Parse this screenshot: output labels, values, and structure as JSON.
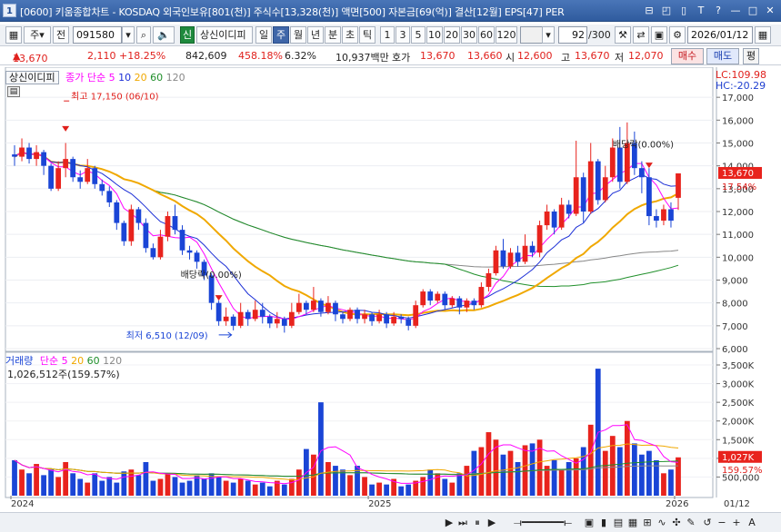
{
  "window": {
    "badge": "1",
    "title": "[0600] 키움종합차트 - KOSDAQ 외국인보유[801(천)] 주식수[13,328(천)] 액면[500] 자본금[69(억)] 결산[12월] EPS[47] PER",
    "buttons": [
      "⊟",
      "◰",
      "▯",
      "T",
      "?",
      "—",
      "□",
      "✕"
    ]
  },
  "toolbar": {
    "mode_label": "주",
    "prev_label": "전",
    "code_value": "091580",
    "stock_badge": "신",
    "stock_name": "상신이디피",
    "periods": [
      "일",
      "주",
      "월",
      "년",
      "분",
      "초",
      "틱"
    ],
    "selected_period": "주",
    "intervals": [
      "1",
      "3",
      "5",
      "10",
      "20",
      "30",
      "60",
      "120"
    ],
    "count_value": "92",
    "count_total": "/300",
    "date_value": "2026/01/12"
  },
  "quote": {
    "price": "13,670",
    "change": "2,110",
    "change_pct": "+18.25%",
    "volume": "842,609",
    "vol_ratio": "458.18%",
    "turnover": "6.32%",
    "amount": "10,937백만",
    "bid_label": "호가",
    "bid": "13,670",
    "ask": "13,660",
    "open_label": "시",
    "open": "12,600",
    "high_label": "고",
    "high": "13,670",
    "low_label": "저",
    "low": "12,070",
    "buy_label": "매수",
    "sell_label": "매도",
    "eval_label": "평"
  },
  "price_panel": {
    "name_box": "상신이디피",
    "legend_prefix": "종가 단순",
    "ma": [
      "5",
      "10",
      "20",
      "60",
      "120"
    ],
    "lc": "LC:109.98",
    "hc": "HC:-20.29",
    "annotations": {
      "high": "최고 17,150 (06/10)",
      "low": "최저 6,510 (12/09)",
      "div1": "배당락(0.00%)",
      "div2": "배당락(0.00%)"
    },
    "right_tag_price": "13,670",
    "right_tag_pct": "17.54%"
  },
  "volume_panel": {
    "name_box": "거래량",
    "legend_prefix": "단순",
    "ma": [
      "5",
      "20",
      "60",
      "120"
    ],
    "current": "1,026,512주(159.57%)",
    "right_tag_vol": "1,027K",
    "right_tag_pct": "159.57%"
  },
  "x_axis": {
    "labels": [
      "2024",
      "2025",
      "2026"
    ],
    "right_date": "01/12"
  },
  "colors": {
    "up": "#e8231d",
    "down": "#1a45d6",
    "ma5": "#ff00ff",
    "ma10": "#1c2fd6",
    "ma20": "#f0a800",
    "ma60": "#1f8f2a",
    "ma120": "#888888"
  },
  "chart_data": {
    "type": "candlestick",
    "ylim_price": [
      6000,
      18000
    ],
    "price_ticks": [
      6000,
      7000,
      8000,
      9000,
      10000,
      11000,
      12000,
      13000,
      14000,
      15000,
      16000,
      17000
    ],
    "ylim_volume": [
      0,
      3500000
    ],
    "volume_ticks": [
      "500,000",
      "1,000K",
      "1,500K",
      "2,000K",
      "2,500K",
      "3,000K",
      "3,500K"
    ],
    "candles": [
      [
        14500,
        14400,
        14900,
        14000
      ],
      [
        14400,
        14800,
        15200,
        14200
      ],
      [
        14800,
        14300,
        15000,
        14100
      ],
      [
        14300,
        14600,
        14900,
        14000
      ],
      [
        14600,
        14000,
        14700,
        13600
      ],
      [
        14000,
        13000,
        14100,
        12900
      ],
      [
        13000,
        13900,
        14200,
        12900
      ],
      [
        13900,
        14300,
        15000,
        13500
      ],
      [
        14300,
        13500,
        14400,
        13300
      ],
      [
        13500,
        13300,
        13800,
        13000
      ],
      [
        13300,
        13900,
        14300,
        13200
      ],
      [
        13900,
        13200,
        14000,
        13000
      ],
      [
        13200,
        12900,
        13400,
        12700
      ],
      [
        12900,
        12400,
        13100,
        12200
      ],
      [
        12400,
        11500,
        12500,
        11200
      ],
      [
        11500,
        10700,
        11600,
        10500
      ],
      [
        10700,
        12100,
        12300,
        10500
      ],
      [
        12100,
        11500,
        12200,
        11200
      ],
      [
        11500,
        10400,
        11700,
        10200
      ],
      [
        10400,
        10000,
        10600,
        9900
      ],
      [
        10000,
        10900,
        11200,
        9900
      ],
      [
        10900,
        11800,
        12000,
        10700
      ],
      [
        11800,
        11200,
        12300,
        11000
      ],
      [
        11200,
        10300,
        11400,
        10100
      ],
      [
        10300,
        10200,
        10500,
        9900
      ],
      [
        10200,
        9800,
        10300,
        9500
      ],
      [
        9800,
        9200,
        9900,
        9000
      ],
      [
        9200,
        8000,
        9300,
        7700
      ],
      [
        8000,
        7200,
        8100,
        7000
      ],
      [
        7200,
        7400,
        7800,
        7000
      ],
      [
        7400,
        7000,
        7500,
        6800
      ],
      [
        7000,
        7600,
        8000,
        6900
      ],
      [
        7600,
        7300,
        7700,
        7000
      ],
      [
        7300,
        7700,
        8100,
        7200
      ],
      [
        7700,
        7400,
        8000,
        7100
      ],
      [
        7400,
        7100,
        7500,
        6900
      ],
      [
        7100,
        7300,
        7600,
        6900
      ],
      [
        7300,
        7000,
        7400,
        6700
      ],
      [
        7000,
        7600,
        8000,
        6900
      ],
      [
        7600,
        8000,
        8400,
        7500
      ],
      [
        8000,
        7700,
        8100,
        7500
      ],
      [
        7700,
        8100,
        8700,
        7600
      ],
      [
        8100,
        7600,
        8200,
        7400
      ],
      [
        7600,
        8000,
        8300,
        7500
      ],
      [
        8000,
        7500,
        8100,
        7200
      ],
      [
        7500,
        7300,
        7600,
        7100
      ],
      [
        7300,
        7700,
        7800,
        7200
      ],
      [
        7700,
        7300,
        7800,
        7100
      ],
      [
        7300,
        7500,
        7700,
        7100
      ],
      [
        7500,
        7200,
        7600,
        7000
      ],
      [
        7200,
        7500,
        7700,
        7100
      ],
      [
        7500,
        7100,
        7600,
        6900
      ],
      [
        7100,
        7400,
        7600,
        7000
      ],
      [
        7400,
        7300,
        7500,
        7100
      ],
      [
        7300,
        7000,
        7400,
        6800
      ],
      [
        7000,
        7900,
        8100,
        6900
      ],
      [
        7900,
        8500,
        8600,
        7800
      ],
      [
        8500,
        8100,
        8600,
        7900
      ],
      [
        8100,
        8400,
        8500,
        8000
      ],
      [
        8400,
        7900,
        8500,
        7700
      ],
      [
        7900,
        8200,
        8300,
        7800
      ],
      [
        8200,
        7800,
        8300,
        7500
      ],
      [
        7800,
        8100,
        8200,
        7600
      ],
      [
        8100,
        7900,
        8200,
        7700
      ],
      [
        7900,
        8700,
        8900,
        7800
      ],
      [
        8700,
        9300,
        9500,
        8500
      ],
      [
        9300,
        10300,
        10500,
        9200
      ],
      [
        10300,
        9600,
        10800,
        9500
      ],
      [
        9600,
        10200,
        10400,
        9500
      ],
      [
        10200,
        9800,
        10500,
        9600
      ],
      [
        9800,
        10500,
        11000,
        9700
      ],
      [
        10500,
        10200,
        10700,
        10000
      ],
      [
        10200,
        11400,
        11600,
        10000
      ],
      [
        11400,
        12000,
        12300,
        11200
      ],
      [
        12000,
        11300,
        12100,
        11000
      ],
      [
        11300,
        12300,
        12600,
        11200
      ],
      [
        12300,
        11900,
        12500,
        11700
      ],
      [
        11900,
        13500,
        15100,
        11800
      ],
      [
        13500,
        12000,
        13700,
        11500
      ],
      [
        12000,
        14200,
        15000,
        11900
      ],
      [
        14200,
        12500,
        14300,
        12300
      ],
      [
        12500,
        13500,
        14000,
        12400
      ],
      [
        13500,
        14800,
        15200,
        13300
      ],
      [
        14800,
        13300,
        15700,
        13000
      ],
      [
        13300,
        15000,
        15900,
        13200
      ],
      [
        15000,
        13900,
        15500,
        13600
      ],
      [
        13900,
        13500,
        14200,
        12800
      ],
      [
        13500,
        11800,
        13900,
        11400
      ],
      [
        11800,
        11600,
        12100,
        11300
      ],
      [
        11600,
        12100,
        12300,
        11400
      ],
      [
        12100,
        11600,
        12400,
        11300
      ],
      [
        12600,
        13670,
        13670,
        12070
      ]
    ],
    "volumes": [
      950000,
      700000,
      600000,
      850000,
      550000,
      700000,
      500000,
      900000,
      600000,
      450000,
      350000,
      600000,
      400000,
      500000,
      350000,
      650000,
      700000,
      550000,
      900000,
      400000,
      450000,
      600000,
      500000,
      350000,
      400000,
      550000,
      450000,
      600000,
      500000,
      400000,
      350000,
      450000,
      400000,
      300000,
      350000,
      250000,
      400000,
      300000,
      450000,
      700000,
      1250000,
      1100000,
      2500000,
      900000,
      800000,
      700000,
      550000,
      800000,
      500000,
      300000,
      350000,
      300000,
      450000,
      250000,
      300000,
      400000,
      500000,
      700000,
      600000,
      450000,
      350000,
      600000,
      800000,
      1200000,
      1300000,
      1700000,
      1500000,
      1100000,
      1200000,
      900000,
      1350000,
      1400000,
      1500000,
      800000,
      950000,
      700000,
      900000,
      1000000,
      1300000,
      1900000,
      3400000,
      1200000,
      1600000,
      1300000,
      2000000,
      1400000,
      1100000,
      1200000,
      950000,
      600000,
      700000,
      1026512
    ],
    "x_labels": [
      "2024",
      "2025",
      "2026"
    ]
  }
}
